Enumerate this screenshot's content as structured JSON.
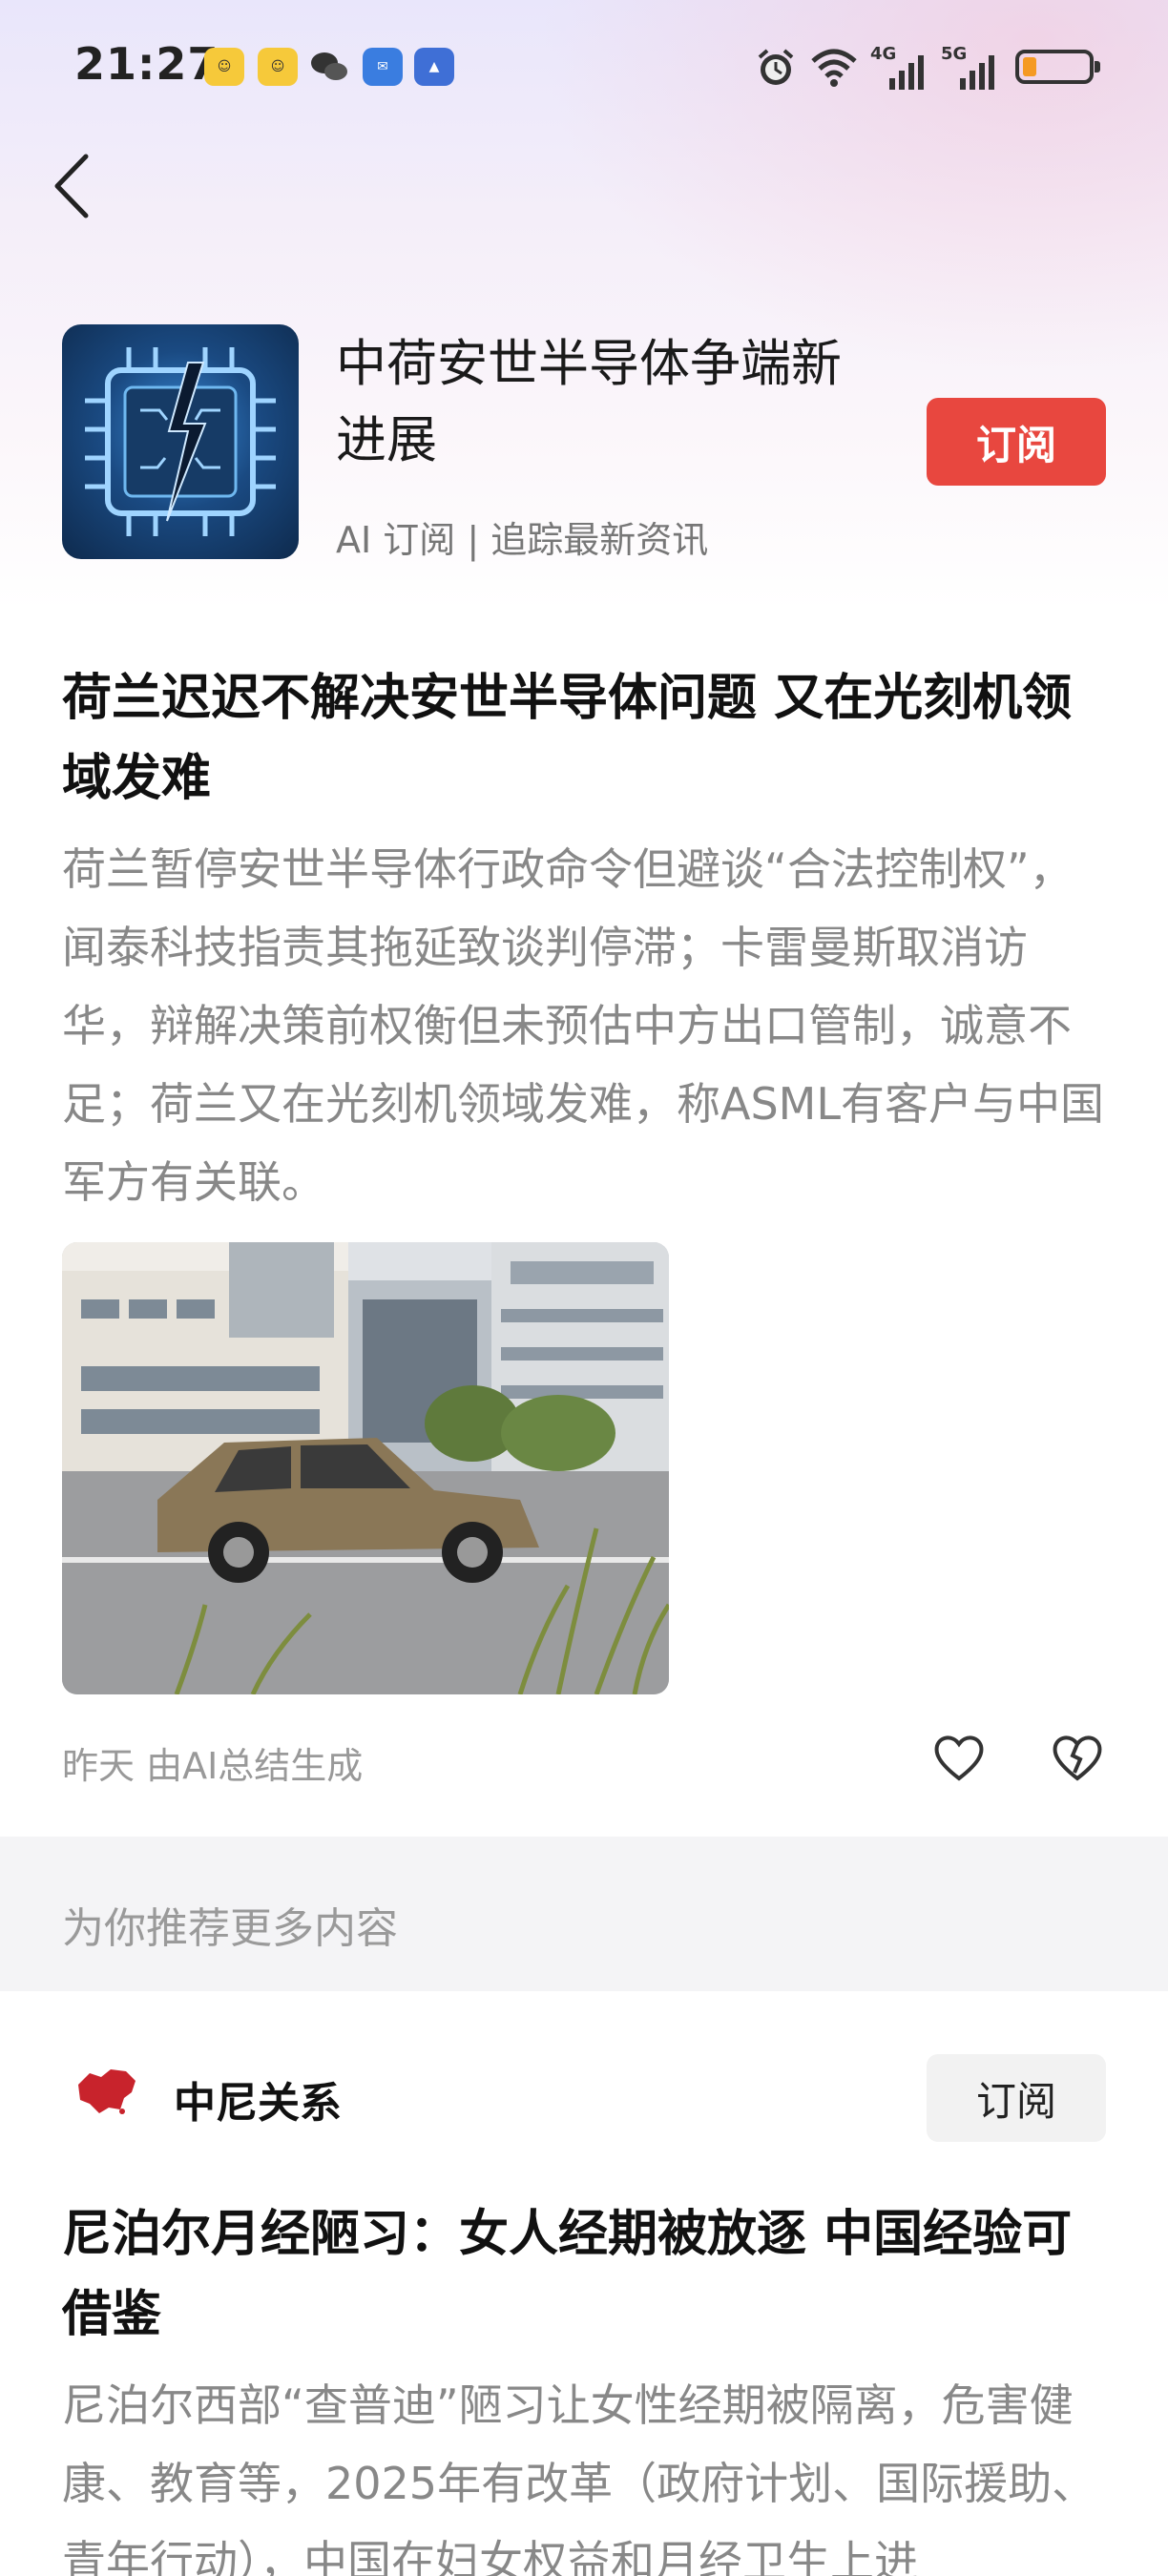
{
  "status_bar": {
    "time": "21:27",
    "network_labels": [
      "4G",
      "5G"
    ]
  },
  "topic": {
    "title": "中荷安世半导体争端新进展",
    "subtitle": "AI 订阅 | 追踪最新资讯",
    "subscribe_label": "订阅"
  },
  "article": {
    "title": "荷兰迟迟不解决安世半导体问题 又在光刻机领域发难",
    "summary": "荷兰暂停安世半导体行政命令但避谈“合法控制权”，闻泰科技指责其拖延致谈判停滞；卡雷曼斯取消访华，辩解决策前权衡但未预估中方出口管制，诚意不足；荷兰又在光刻机领域发难，称ASML有客户与中国军方有关联。",
    "meta": "昨天 由AI总结生成"
  },
  "recommend": {
    "label": "为你推荐更多内容"
  },
  "topic2": {
    "name": "中尼关系",
    "subscribe_label": "订阅"
  },
  "article2": {
    "title": "尼泊尔月经陋习：女人经期被放逐 中国经验可借鉴",
    "summary": "尼泊尔西部“查普迪”陋习让女性经期被隔离，危害健康、教育等，2025年有改革（政府计划、国际援助、青年行动），中国在妇女权益和月经卫生上进"
  },
  "colors": {
    "accent_red": "#e8473f",
    "battery": "#f59a23"
  }
}
